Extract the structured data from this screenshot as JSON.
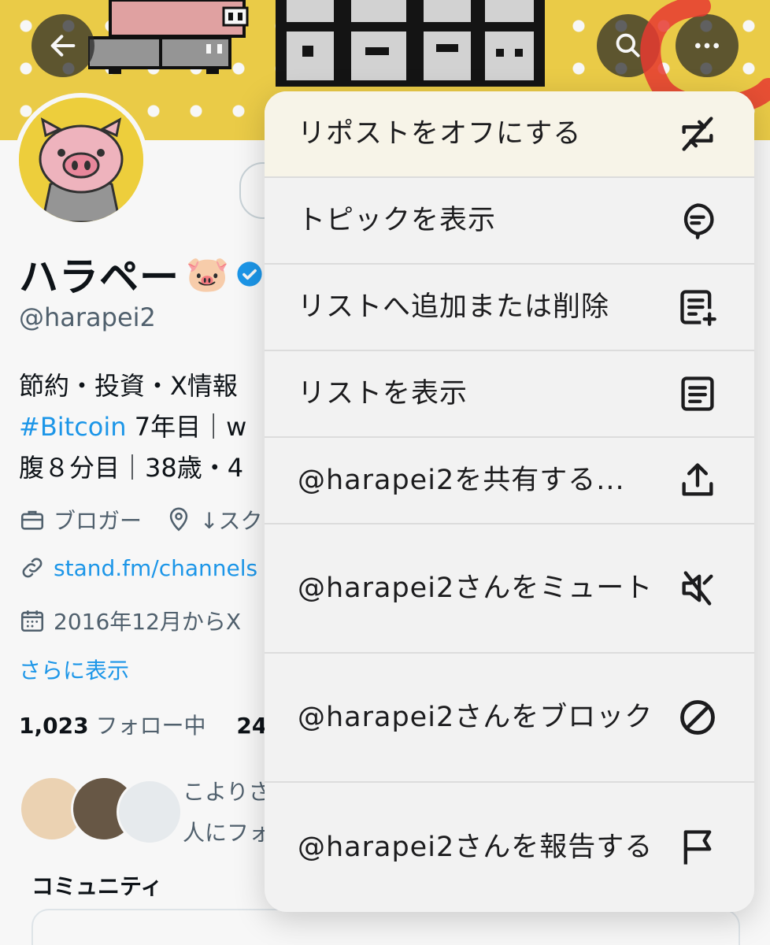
{
  "profile": {
    "name": "ハラペー",
    "name_emoji": "🐷",
    "handle": "@harapei2",
    "bio_line1": "節約・投資・X情報",
    "bio_hashtag": "#Bitcoin",
    "bio_line2_rest": " 7年目｜w",
    "bio_line3": "腹８分目｜38歳・4",
    "category": "ブロガー",
    "location": "↓スク",
    "link": "stand.fm/channels",
    "joined": "2016年12月からX",
    "show_more": "さらに表示",
    "following_count": "1,023",
    "following_label": " フォロー中",
    "followers_count_partial": "24",
    "known_followers_line1": "こよりさ",
    "known_followers_line2": "人にフォ",
    "community_heading": "コミュニティ"
  },
  "menu": {
    "items": [
      {
        "label": "リポストをオフにする",
        "icon": "repost-off-icon"
      },
      {
        "label": "トピックを表示",
        "icon": "topic-icon"
      },
      {
        "label": "リストへ追加または削除",
        "icon": "list-add-icon"
      },
      {
        "label": "リストを表示",
        "icon": "list-icon"
      },
      {
        "label": "@harapei2を共有する...",
        "icon": "share-icon"
      },
      {
        "label": "@harapei2さんをミュート",
        "icon": "mute-icon"
      },
      {
        "label": "@harapei2さんをブロック",
        "icon": "block-icon"
      },
      {
        "label": "@harapei2さんを報告する",
        "icon": "flag-icon"
      }
    ]
  },
  "colors": {
    "accent": "#1d9bf0",
    "banner": "#f2d24a",
    "highlight": "#ee3c32",
    "menu_bg": "#f2f2f2"
  }
}
